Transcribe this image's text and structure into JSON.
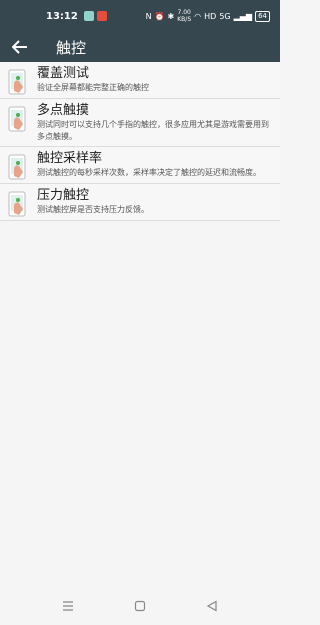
{
  "status_bar": {
    "time": "13:12",
    "network_speed_top": "7.00",
    "network_speed_bottom": "KB/S",
    "network_type": "HD",
    "signal_label": "5G",
    "battery": "64"
  },
  "app_bar": {
    "title": "触控"
  },
  "items": [
    {
      "title": "覆盖测试",
      "desc": "验证全屏幕都能完整正确的触控"
    },
    {
      "title": "多点触摸",
      "desc": "测试同时可以支持几个手指的触控，很多应用尤其是游戏需要用到多点触摸。"
    },
    {
      "title": "触控采样率",
      "desc": "测试触控的每秒采样次数，采样率决定了触控的延迟和流畅度。"
    },
    {
      "title": "压力触控",
      "desc": "测试触控屏是否支持压力反馈。"
    }
  ],
  "colors": {
    "header": "#37474f",
    "background": "#f5f5f5"
  },
  "icons": {
    "item": "hand-touch-icon",
    "back": "arrow-left-icon"
  }
}
